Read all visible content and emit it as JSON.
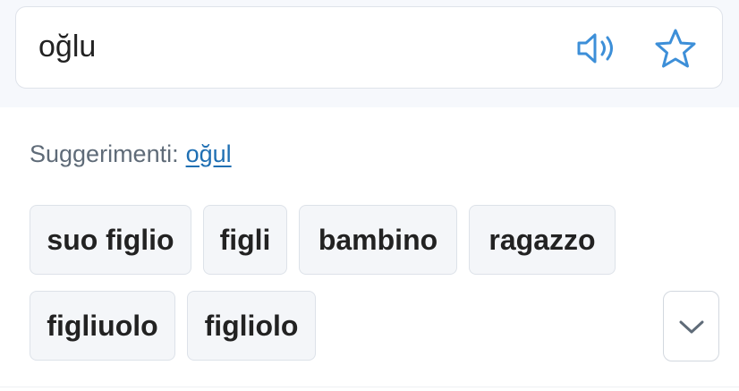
{
  "search": {
    "query": "oğlu",
    "speaker_icon": "speaker-icon",
    "star_icon": "star-icon"
  },
  "suggestions": {
    "label": "Suggerimenti:",
    "link": "oğul"
  },
  "translations": [
    "suo figlio",
    "figli",
    "bambino",
    "ragazzo",
    "figliuolo",
    "figliolo"
  ],
  "expand": {
    "icon": "chevron-down-icon"
  },
  "colors": {
    "accent": "#3d8fd8",
    "link": "#1f6fb3",
    "chip_bg": "#f4f6f9"
  }
}
